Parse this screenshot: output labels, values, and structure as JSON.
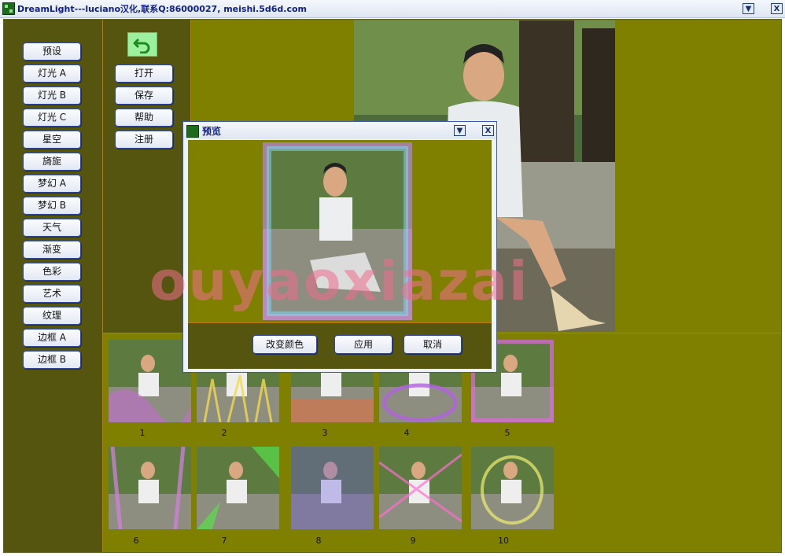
{
  "window": {
    "title": "DreamLight---luciano汉化,联系Q:86000027, meishi.5d6d.com",
    "minimize_glyph": "▼",
    "close_glyph": "X"
  },
  "left_menu": {
    "items": [
      "预设",
      "灯光 A",
      "灯光 B",
      "灯光 C",
      "星空",
      "旖旎",
      "梦幻 A",
      "梦幻 B",
      "天气",
      "渐变",
      "色彩",
      "艺术",
      "纹理",
      "边框 A",
      "边框 B"
    ]
  },
  "file_menu": {
    "undo_icon": "undo-arrow-icon",
    "open": "打开",
    "save": "保存",
    "help": "帮助",
    "register": "注册"
  },
  "thumbnails": {
    "labels": [
      "1",
      "2",
      "3",
      "4",
      "5",
      "6",
      "7",
      "8",
      "9",
      "10"
    ]
  },
  "watermark": "ouyaoxiazai",
  "preview_dialog": {
    "title": "预览",
    "minimize_glyph": "▼",
    "close_glyph": "X",
    "change_color": "改变颜色",
    "apply": "应用",
    "cancel": "取消"
  },
  "colors": {
    "olive": "#808000",
    "dark_olive": "#555510",
    "divider": "#c0780f",
    "title_text": "#10208a"
  }
}
